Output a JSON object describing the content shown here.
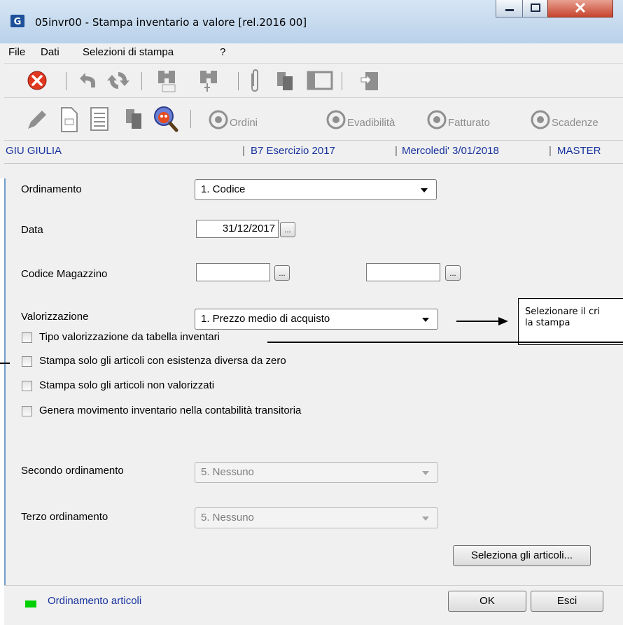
{
  "window": {
    "title": "05invr00 - Stampa inventario a valore  [rel.2016 00]"
  },
  "menu": {
    "items": [
      "File",
      "Dati",
      "Selezioni di stampa",
      "?"
    ]
  },
  "toolbar2": {
    "ordini": "Ordini",
    "evadibilita": "Evadibilità",
    "fatturato": "Fatturato",
    "scadenze": "Scadenze"
  },
  "status": {
    "user": "GIU GIULIA",
    "esercizio": "B7 Esercizio 2017",
    "date": "Mercoledi' 3/01/2018",
    "master": "MASTER"
  },
  "form": {
    "ordinamento_label": "Ordinamento",
    "ordinamento_value": "1. Codice",
    "data_label": "Data",
    "data_value": "31/12/2017",
    "codice_magazzino_label": "Codice Magazzino",
    "codice_magazzino_from": "",
    "codice_magazzino_to": "",
    "valorizzazione_label": "Valorizzazione",
    "valorizzazione_value": "1. Prezzo medio di acquisto",
    "chk_tipo": "Tipo valorizzazione da tabella inventari",
    "chk_esistenza": "Stampa solo gli articoli con esistenza diversa da zero",
    "chk_non_valorizzati": "Stampa solo gli articoli non valorizzati",
    "chk_genera": "Genera movimento inventario nella contabilità transitoria",
    "secondo_label": "Secondo ordinamento",
    "secondo_value": "5. Nessuno",
    "terzo_label": "Terzo ordinamento",
    "terzo_value": "5. Nessuno",
    "seleziona_button": "Seleziona gli articoli...",
    "dots": "..."
  },
  "callout": {
    "text": "Selezionare il cri\nla stampa"
  },
  "bottom": {
    "status_text": "Ordinamento articoli",
    "status_color": "#00d000",
    "ok": "OK",
    "esci": "Esci"
  }
}
